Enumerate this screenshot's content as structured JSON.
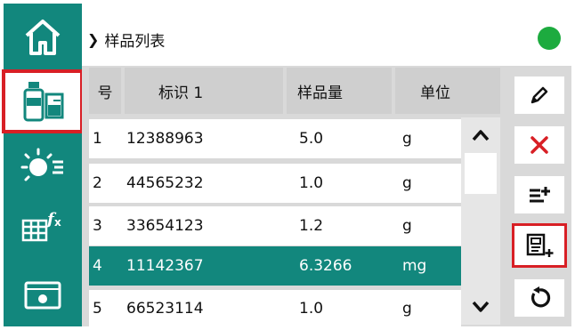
{
  "breadcrumb": {
    "label": "样品列表"
  },
  "table": {
    "headers": [
      "号",
      "标识 1",
      "样品量",
      "单位"
    ],
    "rows": [
      {
        "no": "1",
        "id": "12388963",
        "amount": "5.0",
        "unit": "g"
      },
      {
        "no": "2",
        "id": "44565232",
        "amount": "1.0",
        "unit": "g"
      },
      {
        "no": "3",
        "id": "33654123",
        "amount": "1.2",
        "unit": "g"
      },
      {
        "no": "4",
        "id": "11142367",
        "amount": "6.3266",
        "unit": "mg"
      },
      {
        "no": "5",
        "id": "66523114",
        "amount": "1.0",
        "unit": "g"
      }
    ],
    "selected_row": 4
  },
  "sidebar": {
    "items": [
      {
        "icon": "home-icon"
      },
      {
        "icon": "samples-icon",
        "selected": true
      },
      {
        "icon": "settings-sun-icon"
      },
      {
        "icon": "formula-table-icon"
      },
      {
        "icon": "screen-icon"
      }
    ]
  },
  "actions": {
    "items": [
      {
        "icon": "edit-pencil-icon"
      },
      {
        "icon": "delete-x-icon"
      },
      {
        "icon": "add-list-icon"
      },
      {
        "icon": "add-sample-icon",
        "selected": true
      },
      {
        "icon": "reset-icon"
      }
    ]
  },
  "colors": {
    "accent": "#12877d",
    "highlight": "#d81f25",
    "status": "#1dab3f"
  }
}
